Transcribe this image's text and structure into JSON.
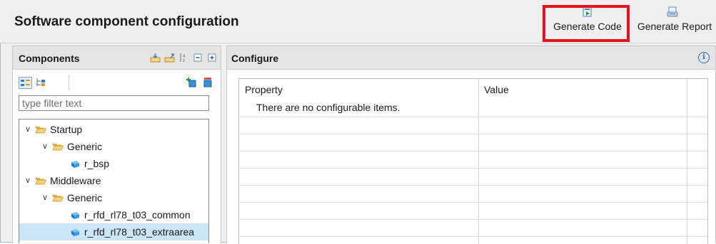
{
  "header": {
    "title": "Software component configuration",
    "generate_code_label": "Generate Code",
    "generate_report_label": "Generate Report",
    "highlight_color": "#e8101a"
  },
  "components": {
    "title": "Components",
    "tool_icons": [
      "import-icon",
      "export-icon",
      "sort-alpha-icon",
      "collapse-all-icon",
      "expand-all-icon"
    ],
    "view_icons": [
      "category-view-icon",
      "hierarchy-view-icon"
    ],
    "action_icons": [
      "add-component-icon",
      "remove-component-icon"
    ],
    "filter": {
      "value": "",
      "placeholder": "type filter text"
    },
    "tree": [
      {
        "label": "Startup",
        "type": "folder",
        "level": 0,
        "expanded": true
      },
      {
        "label": "Generic",
        "type": "folder",
        "level": 1,
        "expanded": true
      },
      {
        "label": "r_bsp",
        "type": "component",
        "level": 2
      },
      {
        "label": "Middleware",
        "type": "folder",
        "level": 0,
        "expanded": true
      },
      {
        "label": "Generic",
        "type": "folder",
        "level": 1,
        "expanded": true
      },
      {
        "label": "r_rfd_rl78_t03_common",
        "type": "component",
        "level": 2
      },
      {
        "label": "r_rfd_rl78_t03_extraarea",
        "type": "component",
        "level": 2,
        "selected": true
      }
    ]
  },
  "configure": {
    "title": "Configure",
    "columns": [
      "Property",
      "Value"
    ],
    "empty_message": "There are no configurable items."
  }
}
